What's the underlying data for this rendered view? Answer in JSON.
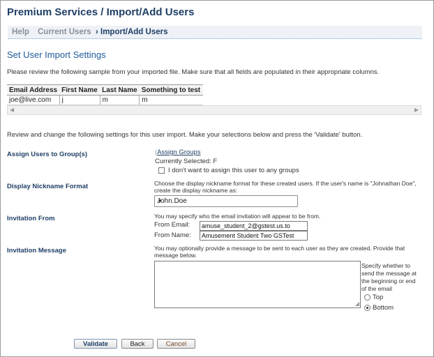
{
  "page": {
    "title": "Premium Services / Import/Add Users"
  },
  "breadcrumb": [
    {
      "label": "Help"
    },
    {
      "label": "Current Users"
    },
    {
      "label": "Import/Add Users"
    }
  ],
  "breadcrumb_sep": "›",
  "settings": {
    "title": "Set User Import Settings",
    "sample_note": "Please review the following sample from your imported file. Make sure that all fields are populated in their appropriate columns.",
    "columns": [
      "Email Address",
      "First Name",
      "Last Name",
      "Something to test"
    ],
    "rows": [
      [
        "joe@live.com",
        "j",
        "m",
        "m"
      ]
    ],
    "review_note": "Review and change the following settings for this user import. Make your selections below and press the 'Validate' button."
  },
  "groups": {
    "label": "Assign Users to Group(s)",
    "link": "Assign Groups",
    "current": "Currently Selected: F",
    "checkbox_label": "I don't want to assign this user to any groups",
    "checked": false
  },
  "nickname": {
    "label": "Display Nickname Format",
    "help": "Choose the display nickname format for these created users. If the user's name is \"Johnathan Doe\", create the display nickname as:",
    "selected": "John.Doe"
  },
  "invitation": {
    "label": "Invitation From",
    "help": "You may specify who the email invitation will appear to be from.",
    "email_label": "From Email:",
    "email_value": "amuse_student_2@gstest.us.to",
    "name_label": "From Name:",
    "name_value": "Amusement Student Two GSTest"
  },
  "message": {
    "label": "Invitation Message",
    "help": "You may optionally provide a message to be sent to each user as they are created. Provide that message below.",
    "position_note": "Specify whether to send the message at the beginning or end of the email",
    "options": [
      "Top",
      "Bottom"
    ],
    "selected": "Bottom",
    "value": ""
  },
  "buttons": {
    "validate": "Validate",
    "back": "Back",
    "cancel": "Cancel"
  }
}
